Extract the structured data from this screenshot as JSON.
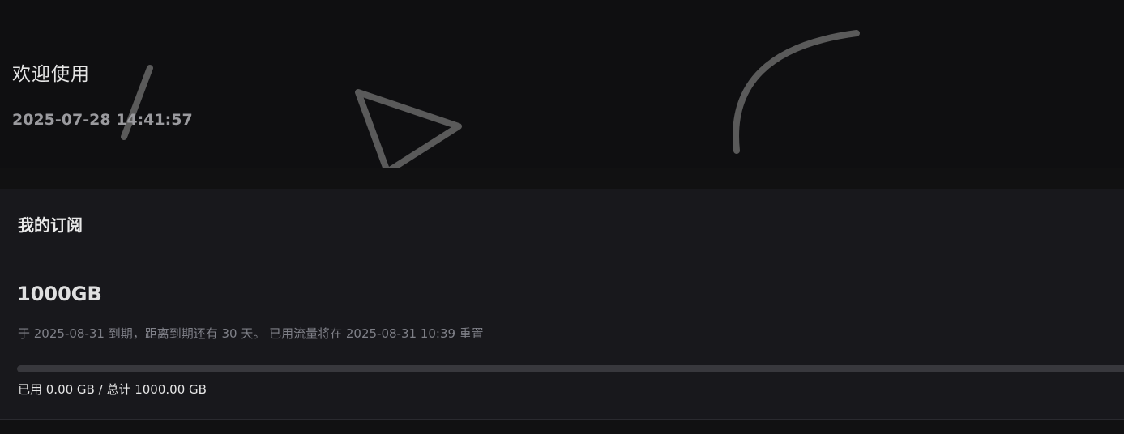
{
  "header": {
    "welcome": "欢迎使用",
    "datetime": "2025-07-28 14:41:57"
  },
  "subscription": {
    "title": "我的订阅",
    "plan": "1000GB",
    "expiry_notice": "于 2025-08-31 到期，距离到期还有 30 天。 已用流量将在 2025-08-31 10:39 重置",
    "usage_fraction": 0,
    "usage_label": "已用 0.00 GB / 总计 1000.00 GB"
  },
  "colors": {
    "background": "#111113",
    "card": "#18181c",
    "decoration": "#5a5a5a",
    "progress_track": "#38383d"
  }
}
